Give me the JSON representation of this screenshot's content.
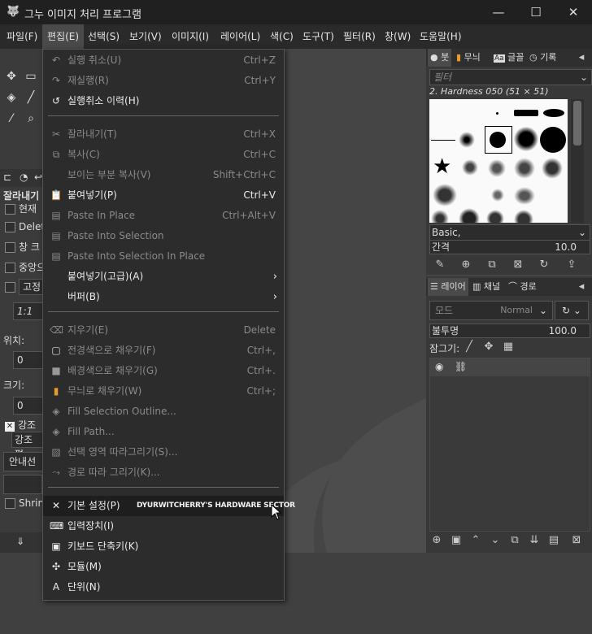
{
  "window": {
    "title": "그누 이미지 처리 프로그램",
    "minimize": "—",
    "maximize": "☐",
    "close": "✕"
  },
  "menubar": {
    "items": [
      "파일(F)",
      "편집(E)",
      "선택(S)",
      "보기(V)",
      "이미지(I)",
      "레이어(L)",
      "색(C)",
      "도구(T)",
      "필터(R)",
      "창(W)",
      "도움말(H)"
    ],
    "active": "편집(E)"
  },
  "edit_menu": {
    "items": [
      {
        "label": "실행 취소(U)",
        "shortcut": "Ctrl+Z",
        "enabled": false,
        "icon": "undo-icon"
      },
      {
        "label": "재실행(R)",
        "shortcut": "Ctrl+Y",
        "enabled": false,
        "icon": "redo-icon"
      },
      {
        "label": "실행취소 이력(H)",
        "shortcut": "",
        "enabled": true,
        "icon": "undo-history-icon"
      },
      {
        "label": "잘라내기(T)",
        "shortcut": "Ctrl+X",
        "enabled": false,
        "icon": "cut-icon"
      },
      {
        "label": "복사(C)",
        "shortcut": "Ctrl+C",
        "enabled": false,
        "icon": "copy-icon"
      },
      {
        "label": "보이는 부분 복사(V)",
        "shortcut": "Shift+Ctrl+C",
        "enabled": false,
        "icon": ""
      },
      {
        "label": "붙여넣기(P)",
        "shortcut": "Ctrl+V",
        "enabled": true,
        "icon": "paste-icon"
      },
      {
        "label": "Paste In Place",
        "shortcut": "Ctrl+Alt+V",
        "enabled": false,
        "icon": "paste-in-place-icon"
      },
      {
        "label": "Paste Into Selection",
        "shortcut": "",
        "enabled": false,
        "icon": "paste-into-icon"
      },
      {
        "label": "Paste Into Selection In Place",
        "shortcut": "",
        "enabled": false,
        "icon": "paste-into-in-place-icon"
      },
      {
        "label": "붙여넣기(고급)(A)",
        "shortcut": "",
        "enabled": true,
        "icon": "",
        "submenu": true
      },
      {
        "label": "버퍼(B)",
        "shortcut": "",
        "enabled": true,
        "icon": "",
        "submenu": true
      },
      {
        "label": "지우기(E)",
        "shortcut": "Delete",
        "enabled": false,
        "icon": "clear-icon"
      },
      {
        "label": "전경색으로 채우기(F)",
        "shortcut": "Ctrl+,",
        "enabled": false,
        "icon": "fill-fg-icon"
      },
      {
        "label": "배경색으로 채우기(G)",
        "shortcut": "Ctrl+.",
        "enabled": false,
        "icon": "fill-bg-icon"
      },
      {
        "label": "무늬로 채우기(W)",
        "shortcut": "Ctrl+;",
        "enabled": false,
        "icon": "fill-pattern-icon"
      },
      {
        "label": "Fill Selection Outline...",
        "shortcut": "",
        "enabled": false,
        "icon": "fill-outline-icon"
      },
      {
        "label": "Fill Path...",
        "shortcut": "",
        "enabled": false,
        "icon": "fill-path-icon"
      },
      {
        "label": "선택 영역 따라그리기(S)...",
        "shortcut": "",
        "enabled": false,
        "icon": "stroke-selection-icon"
      },
      {
        "label": "경로 따라 그리기(K)...",
        "shortcut": "",
        "enabled": false,
        "icon": "stroke-path-icon"
      },
      {
        "label": "기본 설정(P)",
        "shortcut": "",
        "enabled": true,
        "icon": "preferences-icon",
        "highlighted": true
      },
      {
        "label": "입력장치(I)",
        "shortcut": "",
        "enabled": true,
        "icon": "input-devices-icon"
      },
      {
        "label": "키보드 단축키(K)",
        "shortcut": "",
        "enabled": true,
        "icon": "keyboard-icon"
      },
      {
        "label": "모듈(M)",
        "shortcut": "",
        "enabled": true,
        "icon": "modules-icon"
      },
      {
        "label": "단위(N)",
        "shortcut": "",
        "enabled": true,
        "icon": "units-icon"
      }
    ],
    "watermark": "DYURWITCHERRY'S HARDWARE SECTOR"
  },
  "tool_options": {
    "title": "잘라내기",
    "options": [
      "현재",
      "Delete",
      "창 크",
      "중앙으",
      "고정"
    ],
    "ratio": "1:1",
    "position_label": "위치:",
    "position_value": "0",
    "size_label": "크기:",
    "size_value": "0",
    "highlight_label": "강조",
    "highlight_dropdown": "강조 평",
    "guides": "안내선",
    "shrink": "Shrink"
  },
  "brushes_dock": {
    "tabs": [
      "붓",
      "무늬",
      "글꼴",
      "기록"
    ],
    "filter_placeholder": "필터",
    "selected_brush": "2. Hardness 050 (51 × 51)",
    "preset": "Basic,",
    "spacing_label": "간격",
    "spacing_value": "10.0"
  },
  "layers_dock": {
    "tabs": [
      "레이어",
      "채널",
      "경로"
    ],
    "mode_label": "모드",
    "mode_value": "Normal",
    "opacity_label": "불투명",
    "opacity_value": "100.0",
    "lock_label": "잠그기:"
  },
  "colors": {
    "menu_bg": "#2c2c2c",
    "titlebar": "#202020",
    "highlight": "#1e1e1e"
  }
}
